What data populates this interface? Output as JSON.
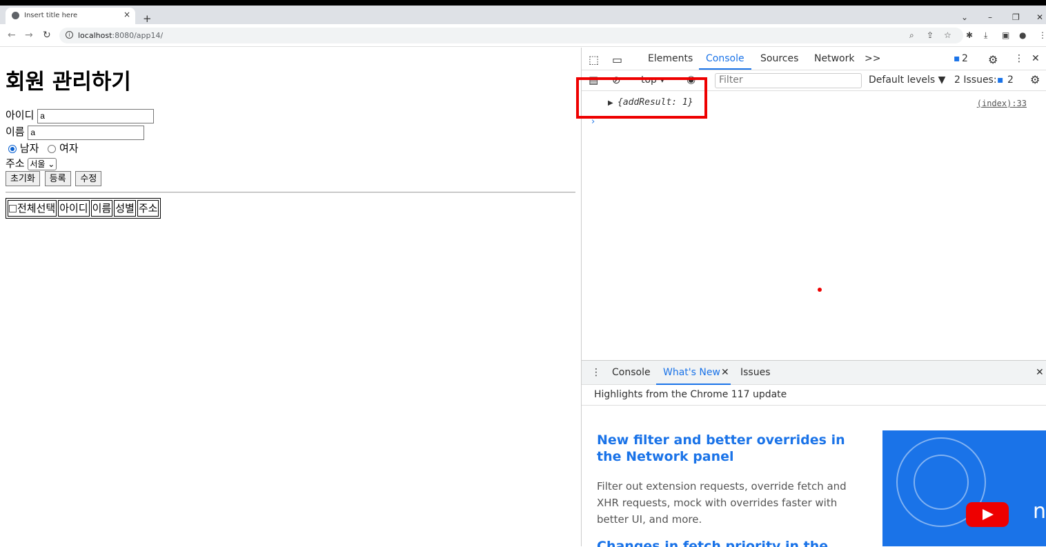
{
  "browser": {
    "tab_title": "Insert title here",
    "tab_close": "×",
    "new_tab": "+",
    "url_host": "localhost",
    "url_rest": ":8080/app14/"
  },
  "page": {
    "heading": "회원 관리하기",
    "id_label": "아이디",
    "id_value": "a",
    "name_label": "이름",
    "name_value": "a",
    "gender_male": "남자",
    "gender_female": "여자",
    "address_label": "주소",
    "address_selected": "서울",
    "buttons": {
      "reset": "초기화",
      "register": "등록",
      "edit": "수정"
    },
    "table_headers": {
      "select_all": "전체선택",
      "id": "아이디",
      "name": "이름",
      "gender": "성별",
      "address": "주소"
    }
  },
  "devtools": {
    "tabs": {
      "elements": "Elements",
      "console": "Console",
      "sources": "Sources",
      "network": "Network",
      "more": ">>"
    },
    "message_count": "2",
    "context": "top",
    "filter_placeholder": "Filter",
    "levels": "Default levels ▼",
    "issues_label": "2 Issues:",
    "issues_count": "2",
    "log_entry": "{addResult: 1}",
    "log_source": "(index):33",
    "drawer": {
      "tabs": {
        "console": "Console",
        "whats_new": "What's New",
        "issues": "Issues"
      },
      "highlights": "Highlights from the Chrome 117 update",
      "feature_title": "New filter and better overrides in the Network panel",
      "feature_body": "Filter out extension requests, override fetch and XHR requests, mock with overrides faster with better UI, and more.",
      "next_title": "Changes in fetch priority in the",
      "image_text": "n"
    }
  },
  "colors": {
    "accent": "#1a73e8",
    "highlight": "#ee0000"
  }
}
